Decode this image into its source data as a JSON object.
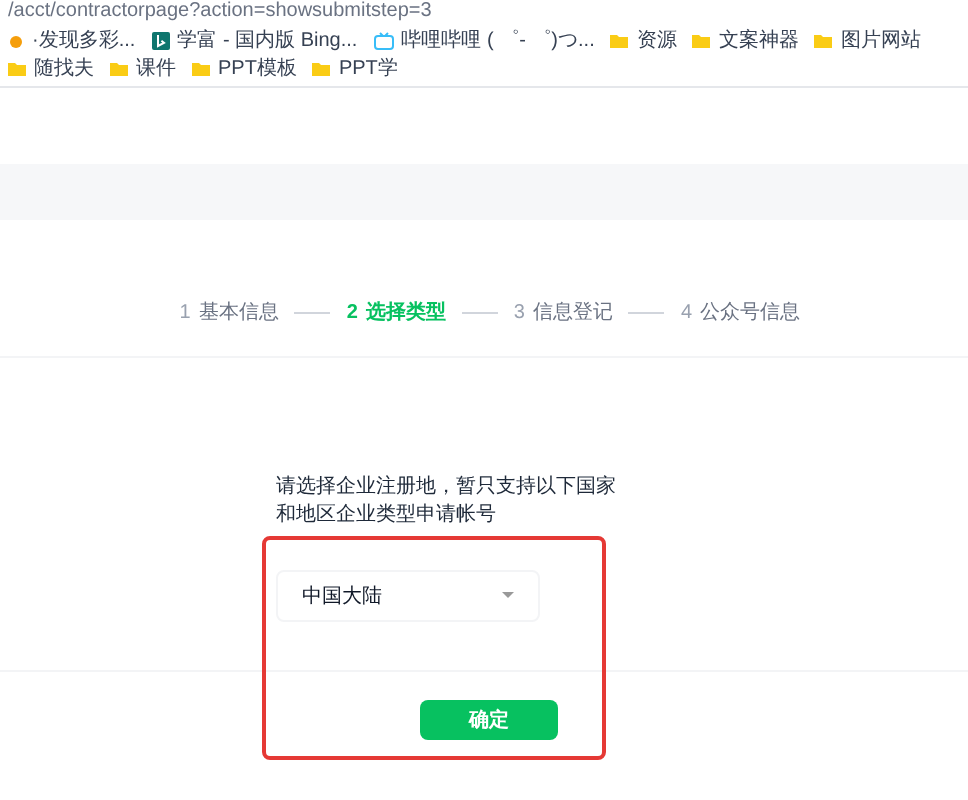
{
  "address_bar": {
    "url": "/acct/contractorpage?action=showsubmitstep=3"
  },
  "bookmarks": [
    {
      "kind": "site",
      "label": "·发现多彩..."
    },
    {
      "kind": "bing",
      "label": "学富 - 国内版 Bing..."
    },
    {
      "kind": "tv",
      "label": "哔哩哔哩 ( ゜- ゜)つ..."
    },
    {
      "kind": "folder",
      "label": "资源"
    },
    {
      "kind": "folder",
      "label": "文案神器"
    },
    {
      "kind": "folder",
      "label": "图片网站"
    },
    {
      "kind": "folder",
      "label": "随找夫"
    },
    {
      "kind": "folder",
      "label": "课件"
    },
    {
      "kind": "folder",
      "label": "PPT模板"
    },
    {
      "kind": "folder",
      "label": "PPT学"
    }
  ],
  "steps": [
    {
      "number": "1",
      "label": "基本信息",
      "selected": false
    },
    {
      "number": "2",
      "label": "选择类型",
      "selected": true
    },
    {
      "number": "3",
      "label": "信息登记",
      "selected": false
    },
    {
      "number": "4",
      "label": "公众号信息",
      "selected": false
    }
  ],
  "prompt": "请选择企业注册地，暂只支持以下国家和地区企业类型申请帐号",
  "region_select": {
    "value": "中国大陆"
  },
  "confirm_button": "确定"
}
